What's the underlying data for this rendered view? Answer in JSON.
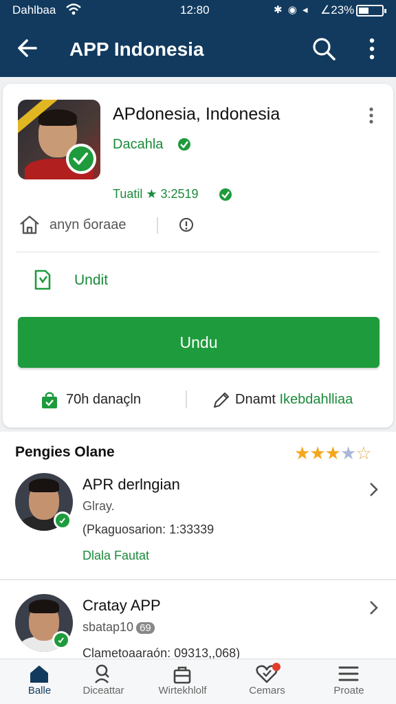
{
  "status_bar": {
    "carrier": "Dahlbaa",
    "time": "12:80",
    "system_icons": "✱ ◉ ◂",
    "battery": "∠23%"
  },
  "app_bar": {
    "title": "APP Indonesia",
    "icons": [
      "back-arrow-icon",
      "search-icon",
      "more-vert-icon"
    ]
  },
  "profile": {
    "name": "APdonesia, Indonesia",
    "subtitle": "Dacahla",
    "stats": "Tuatil ★ 3:2519",
    "location": "anyn бoraae",
    "download_label": "Undit",
    "primary_button": "Undu",
    "stat_left": "70h danaçln",
    "stat_right_1": "Dnamt",
    "stat_right_2": "Ikebdahlliaa"
  },
  "section": {
    "title": "Pengies Olane",
    "rating": 3.5,
    "rating_max": 5
  },
  "list": [
    {
      "title": "APR derlngian",
      "sub": "Glray.",
      "meta": "(Pkaguosarion: 1:33339",
      "link": "Dlala Fautat"
    },
    {
      "title": "Cratay APP",
      "sub": "sbatap10",
      "badge": "69",
      "meta": "Clametoaaraón: 09313,,068)"
    }
  ],
  "nav": [
    {
      "label": "Balle",
      "icon": "home-icon",
      "active": true
    },
    {
      "label": "Diceattar",
      "icon": "search-person-icon",
      "active": false
    },
    {
      "label": "Wirtekhlolf",
      "icon": "bag-icon",
      "active": false
    },
    {
      "label": "Cemars",
      "icon": "heart-icon",
      "active": false
    },
    {
      "label": "Proate",
      "icon": "menu-icon",
      "active": false
    }
  ],
  "colors": {
    "app_bar": "#123a5e",
    "accent_green": "#1e9b3c",
    "star": "#f4a71d"
  }
}
